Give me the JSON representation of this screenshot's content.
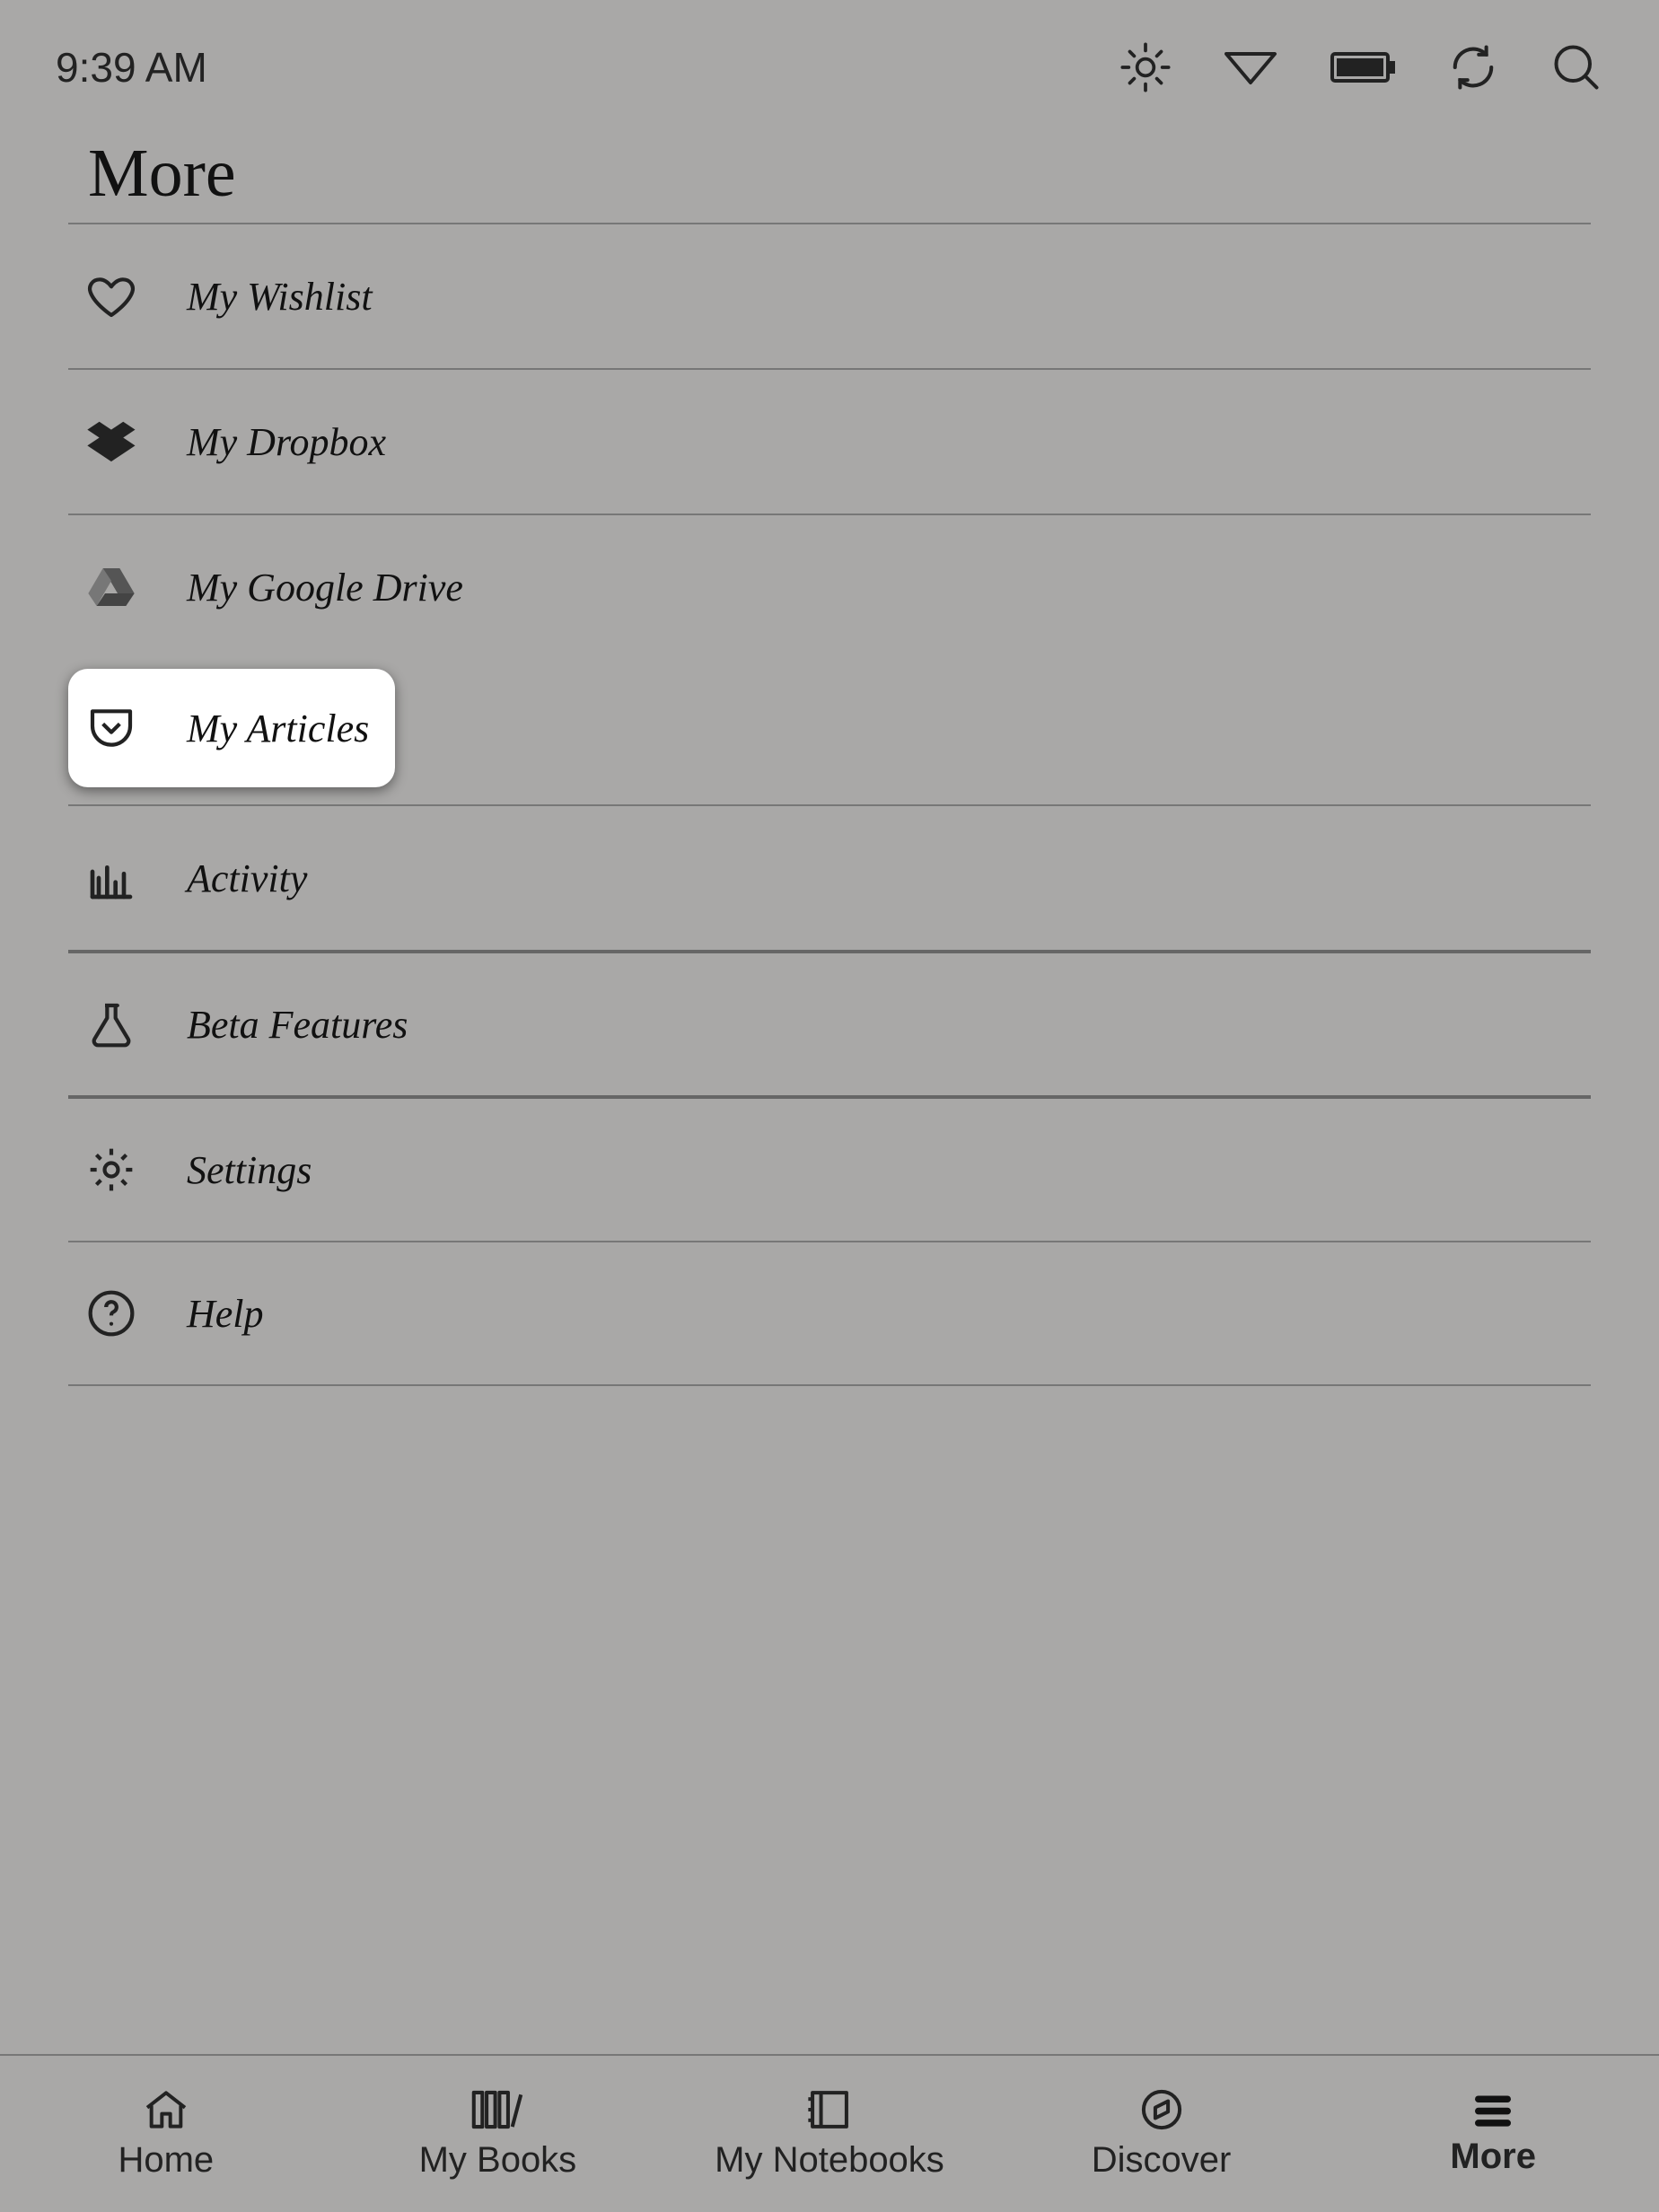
{
  "status": {
    "time": "9:39 AM"
  },
  "page": {
    "title": "More"
  },
  "menu": {
    "items": [
      {
        "label": "My Wishlist"
      },
      {
        "label": "My Dropbox"
      },
      {
        "label": "My Google Drive"
      },
      {
        "label": "My Articles",
        "highlighted": true
      },
      {
        "label": "Activity"
      },
      {
        "label": "Beta Features"
      },
      {
        "label": "Settings"
      },
      {
        "label": "Help"
      }
    ]
  },
  "nav": {
    "items": [
      {
        "label": "Home"
      },
      {
        "label": "My Books"
      },
      {
        "label": "My Notebooks"
      },
      {
        "label": "Discover"
      },
      {
        "label": "More",
        "active": true
      }
    ]
  }
}
